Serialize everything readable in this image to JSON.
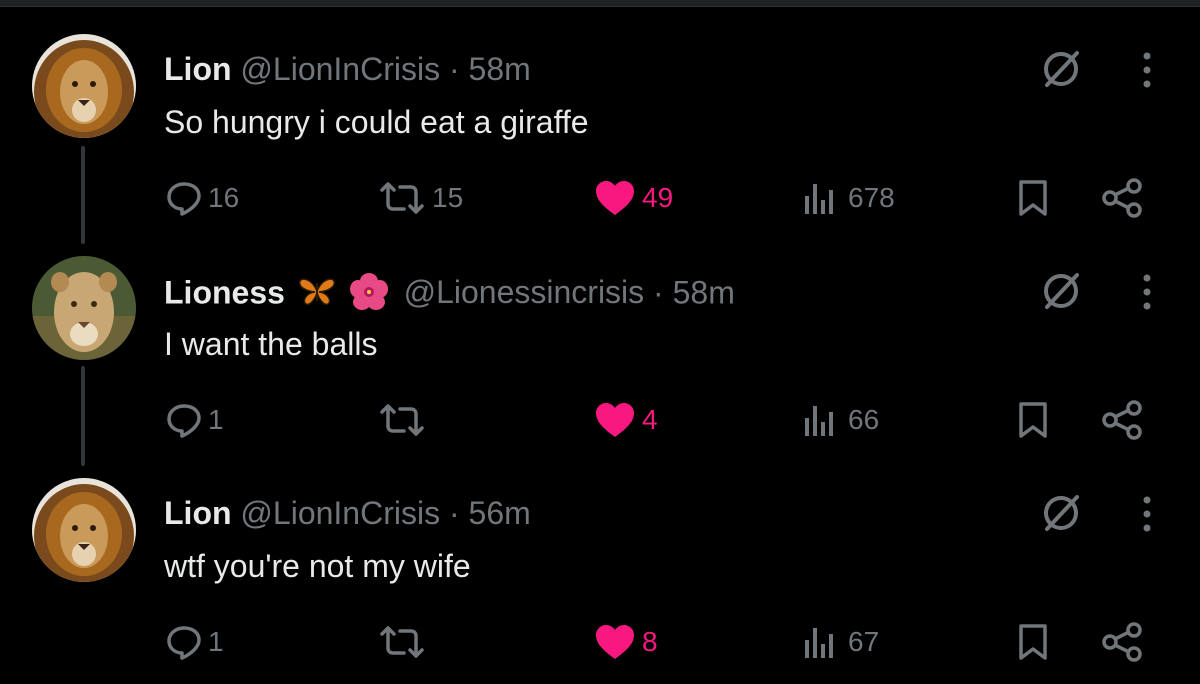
{
  "tweets": [
    {
      "name": "Lion",
      "handle": "@LionInCrisis",
      "separator": "·",
      "time": "58m",
      "text": "So hungry i could eat a giraffe",
      "avatar": "lion-avatar",
      "name_emojis": [],
      "replies": "16",
      "retweets": "15",
      "likes": "49",
      "views": "678",
      "liked": true
    },
    {
      "name": "Lioness",
      "handle": "@Lionessincrisis",
      "separator": "·",
      "time": "58m",
      "text": "I want the balls",
      "avatar": "lioness-avatar",
      "name_emojis": [
        "butterfly-emoji",
        "hibiscus-emoji"
      ],
      "replies": "1",
      "retweets": "",
      "likes": "4",
      "views": "66",
      "liked": true
    },
    {
      "name": "Lion",
      "handle": "@LionInCrisis",
      "separator": "·",
      "time": "56m",
      "text": "wtf you're not my wife",
      "avatar": "lion-avatar",
      "name_emojis": [],
      "replies": "1",
      "retweets": "",
      "likes": "8",
      "views": "67",
      "liked": true
    }
  ],
  "colors": {
    "background": "#000000",
    "text": "#e7e9ea",
    "muted": "#71767b",
    "like": "#f91880",
    "thread_line": "#333639"
  },
  "icons": [
    "reply-icon",
    "retweet-icon",
    "like-icon",
    "views-icon",
    "bookmark-icon",
    "share-icon",
    "grok-icon",
    "more-icon"
  ]
}
